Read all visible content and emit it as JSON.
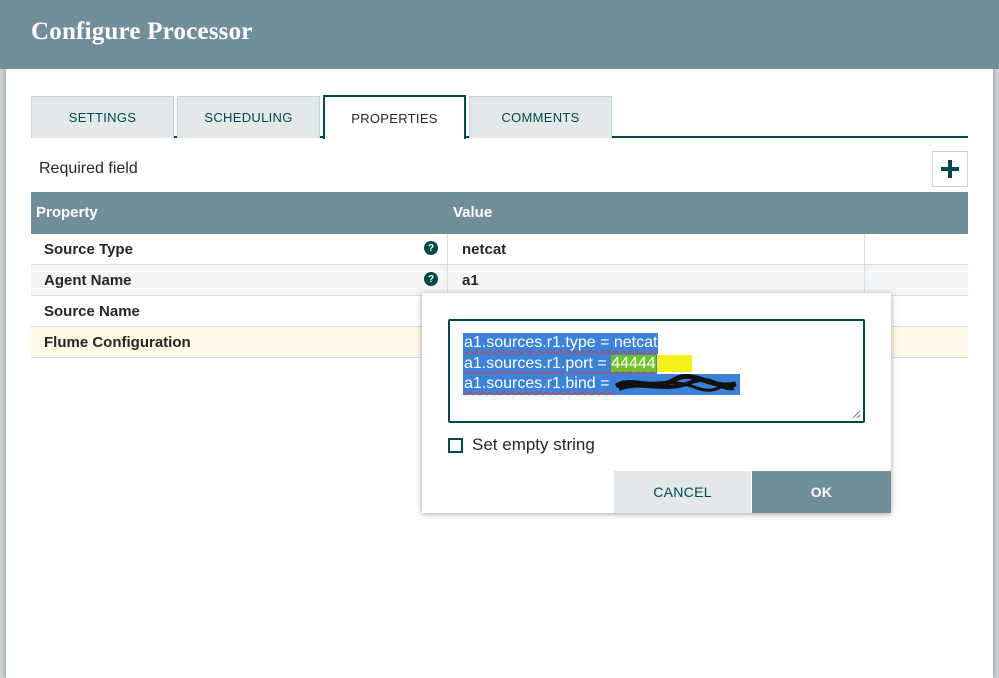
{
  "dialog": {
    "title": "Configure Processor"
  },
  "tabs": [
    {
      "label": "SETTINGS"
    },
    {
      "label": "SCHEDULING"
    },
    {
      "label": "PROPERTIES"
    },
    {
      "label": "COMMENTS"
    }
  ],
  "active_tab": "PROPERTIES",
  "properties": {
    "required_label": "Required field",
    "header": {
      "property": "Property",
      "value": "Value"
    },
    "rows": [
      {
        "name": "Source Type",
        "value": "netcat",
        "help": "?"
      },
      {
        "name": "Agent Name",
        "value": "a1",
        "help": "?"
      },
      {
        "name": "Source Name",
        "value": ""
      },
      {
        "name": "Flume Configuration",
        "value": ""
      }
    ]
  },
  "editor": {
    "lines": [
      "a1.sources.r1.type = netcat",
      "a1.sources.r1.port = ",
      "a1.sources.r1.bind = "
    ],
    "port_value": "44444",
    "empty_string_label": "Set empty string",
    "cancel_label": "CANCEL",
    "ok_label": "OK"
  },
  "colors": {
    "header": "#728e9b",
    "accent": "#004849",
    "selection": "#3b82d8",
    "selected_row": "#fff9e8"
  }
}
